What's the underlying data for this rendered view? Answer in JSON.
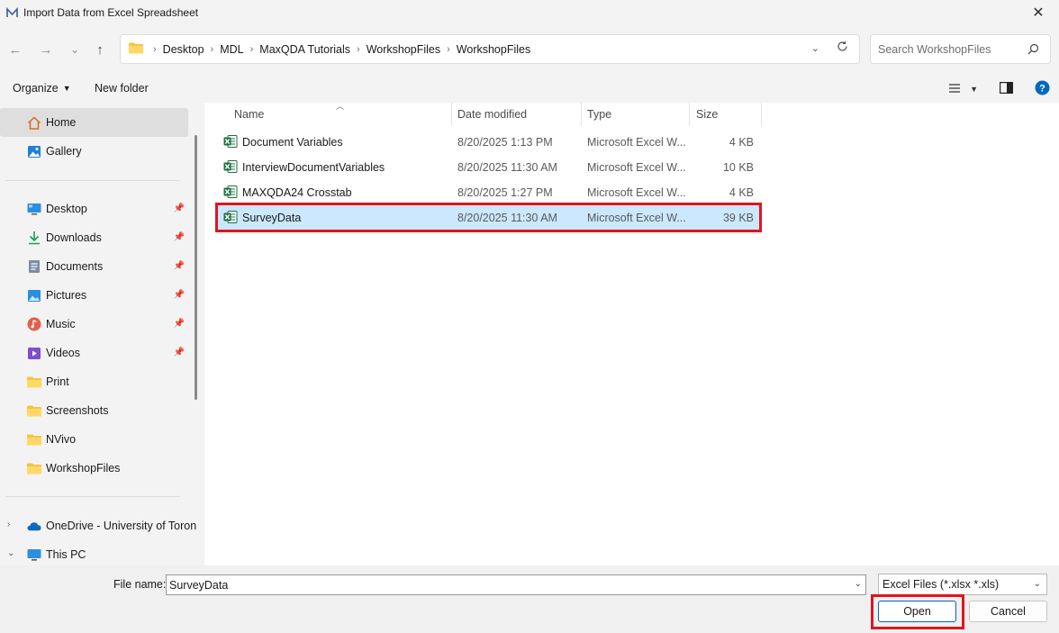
{
  "window": {
    "title": "Import Data from Excel Spreadsheet",
    "close_glyph": "✕"
  },
  "nav": {
    "back": "←",
    "forward": "→",
    "recent": "⌄",
    "up": "↑"
  },
  "breadcrumbs": [
    "Desktop",
    "MDL",
    "MaxQDA Tutorials",
    "WorkshopFiles",
    "WorkshopFiles"
  ],
  "search": {
    "placeholder": "Search WorkshopFiles"
  },
  "toolbar": {
    "organize_label": "Organize",
    "new_folder_label": "New folder"
  },
  "sidebar": {
    "home": "Home",
    "gallery": "Gallery",
    "quick_access": [
      {
        "label": "Desktop",
        "icon": "desktop-icon",
        "pinned": true
      },
      {
        "label": "Downloads",
        "icon": "download-icon",
        "pinned": true
      },
      {
        "label": "Documents",
        "icon": "documents-icon",
        "pinned": true
      },
      {
        "label": "Pictures",
        "icon": "pictures-icon",
        "pinned": true
      },
      {
        "label": "Music",
        "icon": "music-icon",
        "pinned": true
      },
      {
        "label": "Videos",
        "icon": "videos-icon",
        "pinned": true
      },
      {
        "label": "Print",
        "icon": "folder-icon",
        "pinned": false
      },
      {
        "label": "Screenshots",
        "icon": "folder-icon",
        "pinned": false
      },
      {
        "label": "NVivo",
        "icon": "folder-icon",
        "pinned": false
      },
      {
        "label": "WorkshopFiles",
        "icon": "folder-icon",
        "pinned": false
      }
    ],
    "onedrive": "OneDrive - University of Toron",
    "this_pc": "This PC"
  },
  "columns": {
    "name": "Name",
    "date": "Date modified",
    "type": "Type",
    "size": "Size"
  },
  "files": [
    {
      "name": "Document Variables",
      "date": "8/20/2025 1:13 PM",
      "type": "Microsoft Excel W...",
      "size": "4 KB",
      "selected": false
    },
    {
      "name": "InterviewDocumentVariables",
      "date": "8/20/2025 11:30 AM",
      "type": "Microsoft Excel W...",
      "size": "10 KB",
      "selected": false
    },
    {
      "name": "MAXQDA24 Crosstab",
      "date": "8/20/2025 1:27 PM",
      "type": "Microsoft Excel W...",
      "size": "4 KB",
      "selected": false
    },
    {
      "name": "SurveyData",
      "date": "8/20/2025 11:30 AM",
      "type": "Microsoft Excel W...",
      "size": "39 KB",
      "selected": true
    }
  ],
  "footer": {
    "file_name_label": "File name:",
    "file_name_value": "SurveyData",
    "filter_value": "Excel Files (*.xlsx *.xls)",
    "open_label": "Open",
    "cancel_label": "Cancel"
  },
  "colors": {
    "selection": "#cce8ff",
    "highlight": "#e0151f",
    "accent": "#0067c0"
  }
}
